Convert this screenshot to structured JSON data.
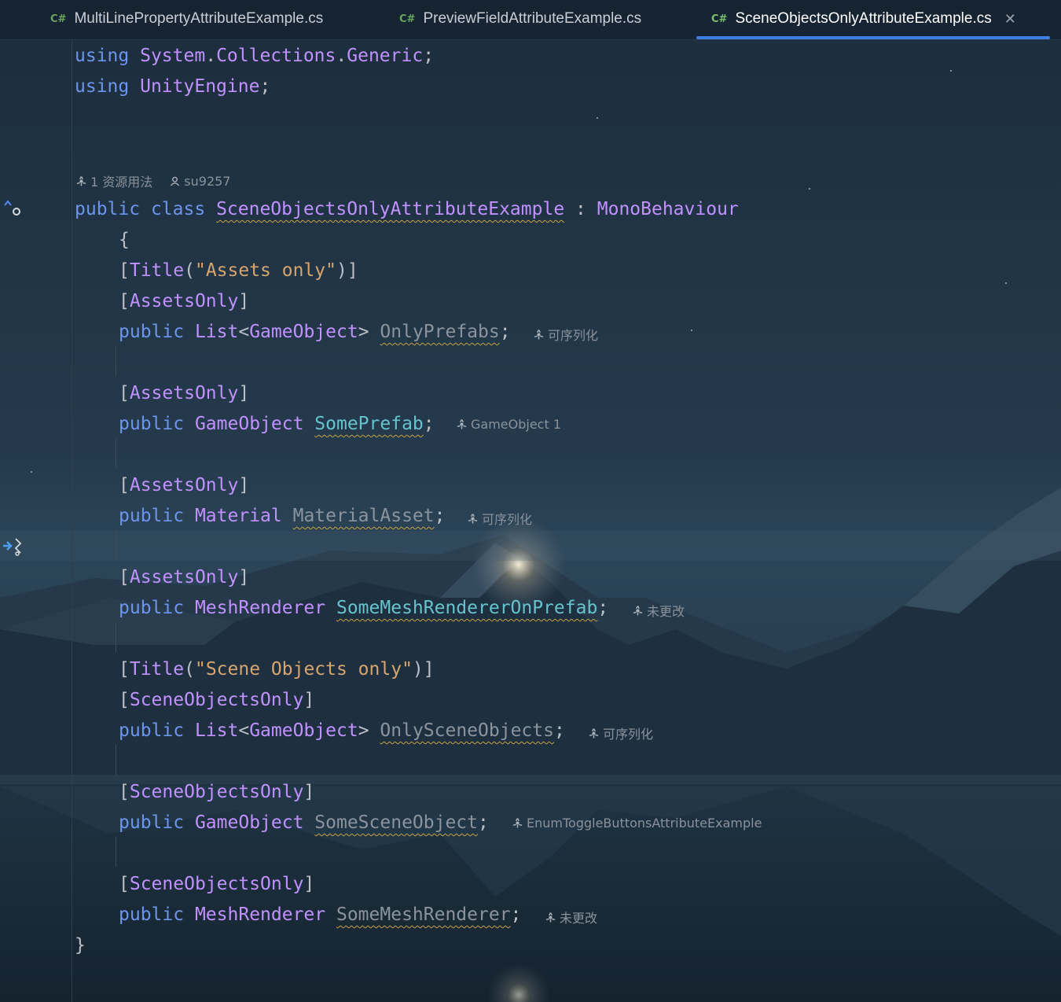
{
  "tabs": [
    {
      "lang": "C#",
      "label": "MultiLinePropertyAttributeExample.cs",
      "active": false
    },
    {
      "lang": "C#",
      "label": "PreviewFieldAttributeExample.cs",
      "active": false
    },
    {
      "lang": "C#",
      "label": "SceneObjectsOnlyAttributeExample.cs",
      "active": true,
      "close": "✕"
    }
  ],
  "code": {
    "l1": {
      "kw": "using",
      "ns1": "System",
      "dot1": ".",
      "ns2": "Collections",
      "dot2": ".",
      "ns3": "Generic",
      "semi": ";"
    },
    "l2": {
      "kw": "using",
      "ns": "UnityEngine",
      "semi": ";"
    },
    "lens": {
      "usages": "1 资源用法",
      "author": "su9257"
    },
    "l3": {
      "kw1": "public",
      "kw2": "class",
      "name": "SceneObjectsOnlyAttributeExample",
      "colon": ":",
      "base": "MonoBehaviour"
    },
    "open_brace": "{",
    "close_brace": "}",
    "title1": {
      "open": "[",
      "attr": "Title",
      "paren": "(",
      "str": "\"Assets only\"",
      "close": ")]"
    },
    "title2": {
      "open": "[",
      "attr": "Title",
      "paren": "(",
      "str": "\"Scene Objects only\"",
      "close": ")]"
    },
    "attr_assets": "AssetsOnly",
    "attr_scene": "SceneObjectsOnly",
    "kw_public": "public",
    "fields": [
      {
        "type": "List",
        "generic": "GameObject",
        "name": "OnlyPrefabs",
        "hint": "可序列化"
      },
      {
        "type": "GameObject",
        "name": "SomePrefab",
        "hint": "GameObject 1"
      },
      {
        "type": "Material",
        "name": "MaterialAsset",
        "hint": "可序列化"
      },
      {
        "type": "MeshRenderer",
        "name": "SomeMeshRendererOnPrefab",
        "hint": "未更改"
      },
      {
        "type": "List",
        "generic": "GameObject",
        "name": "OnlySceneObjects",
        "hint": "可序列化"
      },
      {
        "type": "GameObject",
        "name": "SomeSceneObject",
        "hint": "EnumToggleButtonsAttributeExample"
      },
      {
        "type": "MeshRenderer",
        "name": "SomeMeshRenderer",
        "hint": "未更改"
      }
    ]
  },
  "gutter": {
    "implements_icon": "implements-icon",
    "current_line_icon": "run-to-cursor-icon"
  },
  "colors": {
    "keyword": "#6c95eb",
    "type": "#c191ff",
    "string": "#d7a56d",
    "field": "#66c3cc",
    "tab_underline": "#3d7de6"
  }
}
